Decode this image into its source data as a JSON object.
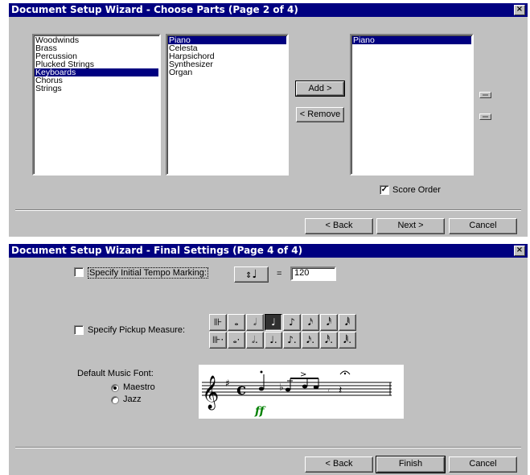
{
  "dialog1": {
    "title": "Document Setup Wizard - Choose Parts (Page 2 of 4)",
    "close_glyph": "×",
    "categories": [
      {
        "label": "Woodwinds",
        "selected": false
      },
      {
        "label": "Brass",
        "selected": false
      },
      {
        "label": "Percussion",
        "selected": false
      },
      {
        "label": "Plucked Strings",
        "selected": false
      },
      {
        "label": "Keyboards",
        "selected": true
      },
      {
        "label": "Chorus",
        "selected": false
      },
      {
        "label": "Strings",
        "selected": false
      }
    ],
    "instruments": [
      {
        "label": "Piano",
        "selected": true
      },
      {
        "label": "Celesta",
        "selected": false
      },
      {
        "label": "Harpsichord",
        "selected": false
      },
      {
        "label": "Synthesizer",
        "selected": false
      },
      {
        "label": "Organ",
        "selected": false
      }
    ],
    "selected_parts": [
      {
        "label": "Piano",
        "selected": true
      }
    ],
    "add_label": "Add >",
    "remove_label": "< Remove",
    "score_order_label": "Score Order",
    "score_order_checked": true,
    "back_label": "< Back",
    "next_label": "Next >",
    "cancel_label": "Cancel"
  },
  "dialog2": {
    "title": "Document Setup Wizard - Final Settings (Page 4 of 4)",
    "close_glyph": "×",
    "tempo_label": "Specify Initial Tempo Marking:",
    "tempo_checked": false,
    "tempo_note_glyph": "♩",
    "equals": "=",
    "tempo_value": "120",
    "pickup_label": "Specify Pickup Measure:",
    "pickup_checked": false,
    "note_row1": [
      "⊪",
      "𝅝",
      "𝅗𝅥",
      "♩",
      "♪",
      "𝅘𝅥𝅯",
      "𝅘𝅥𝅰",
      "𝅘𝅥𝅱"
    ],
    "note_row2": [
      "⊪·",
      "𝅝·",
      "𝅗𝅥.",
      "♩.",
      "♪.",
      "𝅘𝅥𝅯.",
      "𝅘𝅥𝅰.",
      "𝅘𝅥𝅱."
    ],
    "note_selected_index": 3,
    "font_group_label": "Default Music Font:",
    "font_options": [
      {
        "label": "Maestro",
        "selected": true
      },
      {
        "label": "Jazz",
        "selected": false
      }
    ],
    "dynamic_text": "ff",
    "back_label": "< Back",
    "finish_label": "Finish",
    "cancel_label": "Cancel"
  }
}
